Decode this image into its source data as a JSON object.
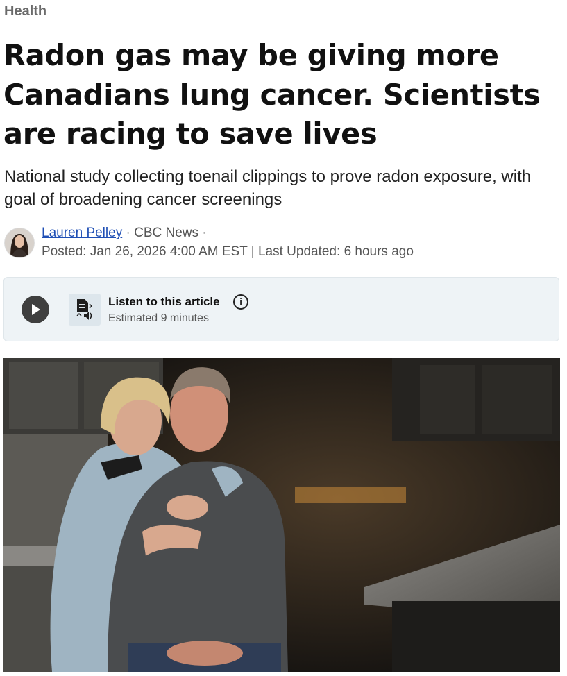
{
  "section": {
    "label": "Health"
  },
  "article": {
    "headline": "Radon gas may be giving more Canadians lung cancer. Scientists are racing to save lives",
    "deck": "National study collecting toenail clippings to prove radon exposure, with goal of broadening cancer screenings"
  },
  "byline": {
    "author": "Lauren Pelley",
    "separator1": " · ",
    "outlet": "CBC News",
    "separator2": " ·",
    "posted_label": "Posted:",
    "posted": "Jan 26, 2026 4:00 AM EST",
    "divider": "|",
    "updated_label": "Last Updated:",
    "updated": "6 hours ago"
  },
  "audio_player": {
    "title": "Listen to this article",
    "duration": "Estimated 9 minutes",
    "play_icon": "play-icon",
    "tts_icon": "document-speaker-icon",
    "info_icon": "info-icon",
    "info_glyph": "i"
  },
  "hero_image": {
    "alt": "Couple posing in a dark kitchen"
  },
  "colors": {
    "section": "#6b6b6b",
    "author_link": "#1f4fb5",
    "player_bg": "#eef3f6",
    "play_button": "#3f3f3f"
  }
}
